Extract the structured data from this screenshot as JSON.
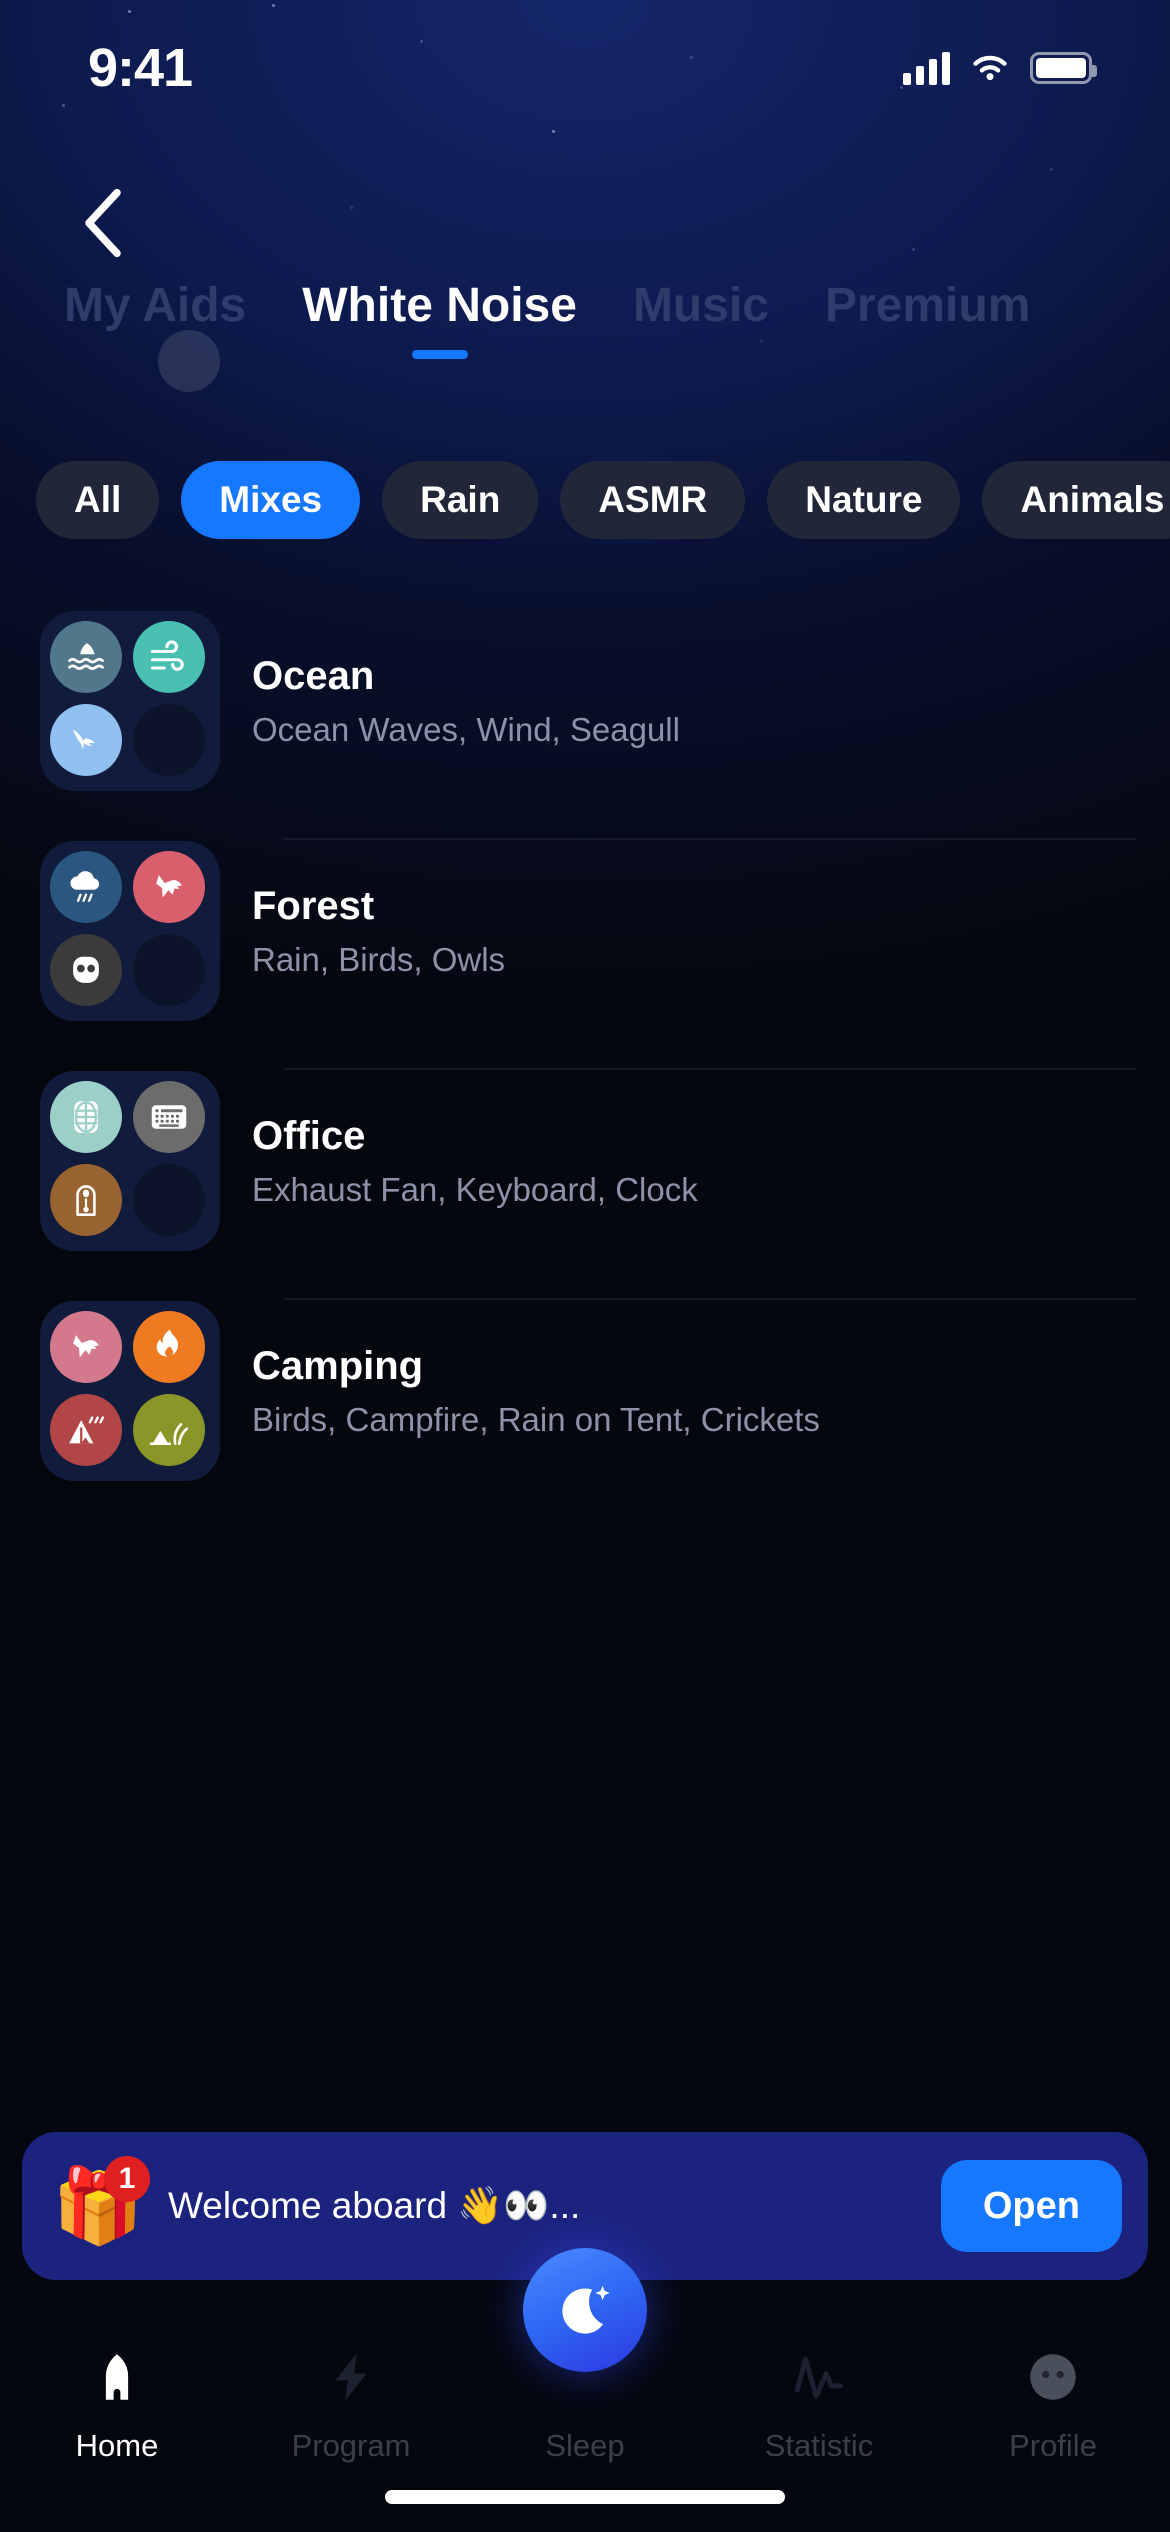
{
  "status_bar": {
    "time": "9:41",
    "signal_icon": "cellular-signal-icon",
    "wifi_icon": "wifi-icon",
    "battery_icon": "battery-icon"
  },
  "nav": {
    "back_icon": "chevron-left-icon"
  },
  "top_tabs": {
    "items": [
      {
        "label": "My Aids",
        "active": false
      },
      {
        "label": "White Noise",
        "active": true
      },
      {
        "label": "Music",
        "active": false
      },
      {
        "label": "Premium",
        "active": false
      }
    ],
    "active_indicator_color": "#1677ff"
  },
  "filter_chips": {
    "items": [
      {
        "label": "All",
        "active": false
      },
      {
        "label": "Mixes",
        "active": true
      },
      {
        "label": "Rain",
        "active": false
      },
      {
        "label": "ASMR",
        "active": false
      },
      {
        "label": "Nature",
        "active": false
      },
      {
        "label": "Animals",
        "active": false
      }
    ],
    "active_color": "#1677ff",
    "inactive_color": "#212738"
  },
  "mix_list": [
    {
      "title": "Ocean",
      "subtitle": "Ocean Waves, Wind, Seagull",
      "icons": [
        {
          "name": "shark-fin-waves-icon",
          "color": "#51788a"
        },
        {
          "name": "wind-icon",
          "color": "#49bfb2"
        },
        {
          "name": "seagull-icon",
          "color": "#8fc0ef"
        },
        {
          "name": "empty-slot",
          "color": "#0c1429"
        }
      ]
    },
    {
      "title": "Forest",
      "subtitle": "Rain, Birds, Owls",
      "icons": [
        {
          "name": "rain-cloud-icon",
          "color": "#2b5680"
        },
        {
          "name": "bird-icon",
          "color": "#d95f6d"
        },
        {
          "name": "owl-icon",
          "color": "#3b3b3b"
        },
        {
          "name": "empty-slot",
          "color": "#0c1429"
        }
      ]
    },
    {
      "title": "Office",
      "subtitle": "Exhaust Fan, Keyboard, Clock",
      "icons": [
        {
          "name": "exhaust-fan-icon",
          "color": "#9ccfc8"
        },
        {
          "name": "keyboard-icon",
          "color": "#6c6c6c"
        },
        {
          "name": "pendulum-clock-icon",
          "color": "#9a6332"
        },
        {
          "name": "empty-slot",
          "color": "#0c1429"
        }
      ]
    },
    {
      "title": "Camping",
      "subtitle": "Birds, Campfire, Rain on Tent, Crickets",
      "icons": [
        {
          "name": "bird-icon",
          "color": "#d4798c"
        },
        {
          "name": "campfire-icon",
          "color": "#ee7b22"
        },
        {
          "name": "tent-rain-icon",
          "color": "#b24646"
        },
        {
          "name": "crickets-grass-icon",
          "color": "#8a9627"
        }
      ]
    }
  ],
  "promo_banner": {
    "gift_icon": "gift-icon",
    "badge_count": "1",
    "message": "Welcome aboard 👋👀...",
    "action_label": "Open",
    "background": "#1c237e",
    "action_color": "#1677ff"
  },
  "bottom_nav": {
    "items": [
      {
        "label": "Home",
        "icon": "home-icon",
        "active": true
      },
      {
        "label": "Program",
        "icon": "lightning-bolt-icon",
        "active": false
      },
      {
        "label": "Sleep",
        "icon": "moon-icon",
        "active": false
      },
      {
        "label": "Statistic",
        "icon": "pulse-wave-icon",
        "active": false
      },
      {
        "label": "Profile",
        "icon": "face-icon",
        "active": false
      }
    ],
    "sleep_fab_icon": "moon-sparkle-icon"
  }
}
